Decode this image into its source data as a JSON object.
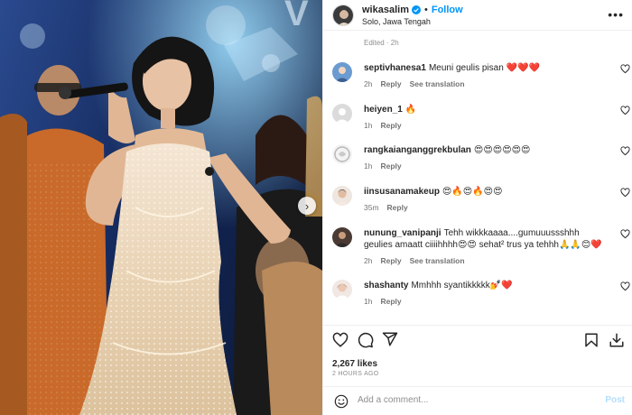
{
  "header": {
    "username": "wikasalim",
    "follow_label": "Follow",
    "location": "Solo, Jawa Tengah",
    "more_label": "•••"
  },
  "edited_label": "Edited · 2h",
  "comments": [
    {
      "username": "septivhanesa1",
      "text": "Meuni geulis pisan ❤️❤️❤️",
      "time": "2h",
      "reply": "Reply",
      "translation": "See translation"
    },
    {
      "username": "heiyen_1",
      "text": "🔥",
      "time": "1h",
      "reply": "Reply",
      "translation": ""
    },
    {
      "username": "rangkaianganggrekbulan",
      "text": "😍😍😍😍😍😍",
      "time": "1h",
      "reply": "Reply",
      "translation": ""
    },
    {
      "username": "iinsusanamakeup",
      "text": "😍🔥😍🔥😍😍",
      "time": "35m",
      "reply": "Reply",
      "translation": ""
    },
    {
      "username": "nunung_vanipanji",
      "text": "Tehh wikkkaaaa....gumuuussshhh geulies amaatt ciiiihhhh😍😍 sehat² trus ya tehhh🙏🙏😊❤️",
      "time": "2h",
      "reply": "Reply",
      "translation": "See translation"
    },
    {
      "username": "shashanty",
      "text": "Mmhhh syantikkkkk💅❤️",
      "time": "1h",
      "reply": "Reply",
      "translation": ""
    }
  ],
  "likes": "2,267 likes",
  "time_ago": "2 HOURS AGO",
  "add_comment": {
    "placeholder": "Add a comment...",
    "post_label": "Post"
  },
  "icons": {
    "like": "heart-icon",
    "comment": "comment-icon",
    "share": "send-icon",
    "save": "bookmark-icon",
    "download": "download-icon",
    "emoji": "emoji-icon",
    "verified": "verified-badge-icon",
    "carousel": "chevron-right-icon"
  },
  "colors": {
    "accent": "#0095f6",
    "verified": "#0095f6",
    "muted": "#8e8e8e",
    "post_disabled": "#b2dffc"
  }
}
